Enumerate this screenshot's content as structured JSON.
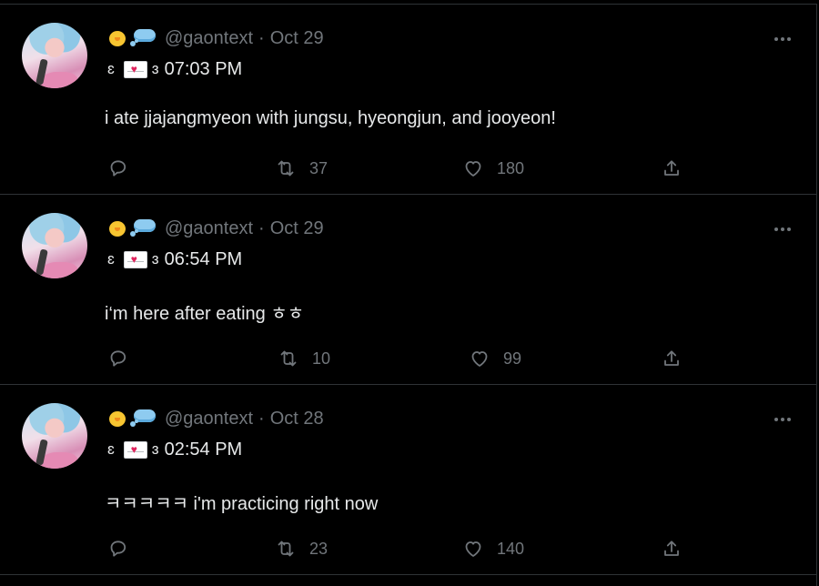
{
  "icons": {
    "emoji_1": "baby-chick-emoji",
    "emoji_2": "thought-balloon-emoji",
    "envelope": "love-letter-emoji",
    "reply": "reply-bubble-icon",
    "retweet": "retweet-arrows-icon",
    "like": "heart-icon",
    "share": "share-upload-icon",
    "more": "three-dots-icon"
  },
  "colors": {
    "background": "#000000",
    "text": "#e7e9ea",
    "muted": "#71767b",
    "divider": "#2f3336"
  },
  "tweets": [
    {
      "handle": "@gaontext",
      "separator": "·",
      "date": "Oct 29",
      "name_left": "ɛ",
      "name_right": "ɜ",
      "name_time": "07:03 PM",
      "text": "i ate jjajangmyeon with jungsu, hyeongjun, and jooyeon!",
      "retweets": "37",
      "likes": "180"
    },
    {
      "handle": "@gaontext",
      "separator": "·",
      "date": "Oct 29",
      "name_left": "ɛ",
      "name_right": "ɜ",
      "name_time": "06:54 PM",
      "text": "i‘m here after eating ㅎㅎ",
      "retweets": "10",
      "likes": "99"
    },
    {
      "handle": "@gaontext",
      "separator": "·",
      "date": "Oct 28",
      "name_left": "ɛ",
      "name_right": "ɜ",
      "name_time": "02:54 PM",
      "text": "ㅋㅋㅋㅋㅋ i'm practicing right now",
      "retweets": "23",
      "likes": "140"
    }
  ]
}
